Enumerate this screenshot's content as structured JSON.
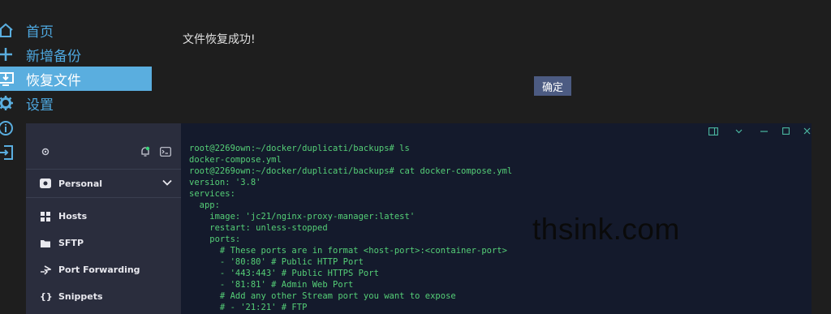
{
  "nav": {
    "items": [
      {
        "label": "首页",
        "icon": "home-icon"
      },
      {
        "label": "新增备份",
        "icon": "plus-icon"
      },
      {
        "label": "恢复文件",
        "icon": "restore-icon",
        "active": true
      },
      {
        "label": "设置",
        "icon": "gear-icon"
      }
    ]
  },
  "main": {
    "message": "文件恢复成功!",
    "confirm_label": "确定"
  },
  "terminal_app": {
    "sidebar": {
      "vault_label": "Personal",
      "items": [
        {
          "label": "Hosts",
          "icon": "hosts-icon"
        },
        {
          "label": "SFTP",
          "icon": "folder-icon"
        },
        {
          "label": "Port Forwarding",
          "icon": "port-forward-icon"
        },
        {
          "label": "Snippets",
          "icon": "braces-icon"
        }
      ]
    },
    "lines": [
      "root@2269own:~/docker/duplicati/backups# ls",
      "docker-compose.yml",
      "root@2269own:~/docker/duplicati/backups# cat docker-compose.yml",
      "version: '3.8'",
      "services:",
      "  app:",
      "    image: 'jc21/nginx-proxy-manager:latest'",
      "    restart: unless-stopped",
      "    ports:",
      "      # These ports are in format <host-port>:<container-port>",
      "      - '80:80' # Public HTTP Port",
      "      - '443:443' # Public HTTPS Port",
      "      - '81:81' # Admin Web Port",
      "      # Add any other Stream port you want to expose",
      "      # - '21:21' # FTP"
    ]
  },
  "watermark": "thsink.com",
  "colors": {
    "accent": "#5aaedf",
    "nav_text": "#4ea8e0",
    "terminal_text": "#55cf77",
    "button": "#4c5b82"
  }
}
